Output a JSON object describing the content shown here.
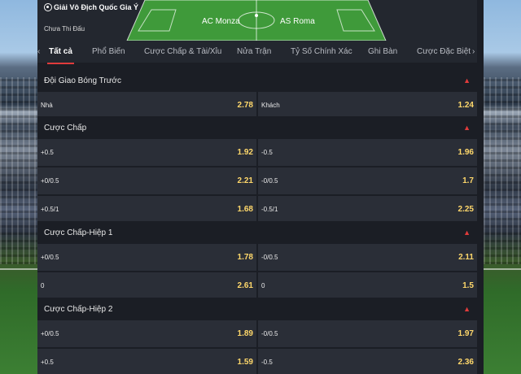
{
  "match": {
    "league": "Giải Vô Địch Quốc Gia Ý",
    "status": "Chưa Thi Đấu",
    "home": "AC Monza",
    "away": "AS Roma"
  },
  "nav": {
    "left_arrow": "‹",
    "right_arrow": "›",
    "tabs": [
      {
        "label": "Tất cả"
      },
      {
        "label": "Phổ Biến"
      },
      {
        "label": "Cược Chấp & Tài/Xỉu"
      },
      {
        "label": "Nửa Trận"
      },
      {
        "label": "Tỷ Số Chính Xác"
      },
      {
        "label": "Ghi Bàn"
      },
      {
        "label": "Cược Đặc Biệt"
      }
    ]
  },
  "markets": [
    {
      "title": "Đội Giao Bóng Trước",
      "rows": [
        [
          {
            "label": "Nhà",
            "odd": "2.78"
          },
          {
            "label": "Khách",
            "odd": "1.24"
          }
        ]
      ]
    },
    {
      "title": "Cược Chấp",
      "rows": [
        [
          {
            "label": "+0.5",
            "odd": "1.92"
          },
          {
            "label": "-0.5",
            "odd": "1.96"
          }
        ],
        [
          {
            "label": "+0/0.5",
            "odd": "2.21"
          },
          {
            "label": "-0/0.5",
            "odd": "1.7"
          }
        ],
        [
          {
            "label": "+0.5/1",
            "odd": "1.68"
          },
          {
            "label": "-0.5/1",
            "odd": "2.25"
          }
        ]
      ]
    },
    {
      "title": "Cược Chấp-Hiệp 1",
      "rows": [
        [
          {
            "label": "+0/0.5",
            "odd": "1.78"
          },
          {
            "label": "-0/0.5",
            "odd": "2.11"
          }
        ],
        [
          {
            "label": "0",
            "odd": "2.61"
          },
          {
            "label": "0",
            "odd": "1.5"
          }
        ]
      ]
    },
    {
      "title": "Cược Chấp-Hiệp 2",
      "rows": [
        [
          {
            "label": "+0/0.5",
            "odd": "1.89"
          },
          {
            "label": "-0/0.5",
            "odd": "1.97"
          }
        ],
        [
          {
            "label": "+0.5",
            "odd": "1.59"
          },
          {
            "label": "-0.5",
            "odd": "2.36"
          }
        ]
      ]
    }
  ],
  "icons": {
    "league": "soccer-ball-icon",
    "collapse": "chevron-up-icon"
  },
  "colors": {
    "accent": "#e03b3b",
    "odds": "#ffd86b",
    "pitch": "#3f9a3a"
  }
}
